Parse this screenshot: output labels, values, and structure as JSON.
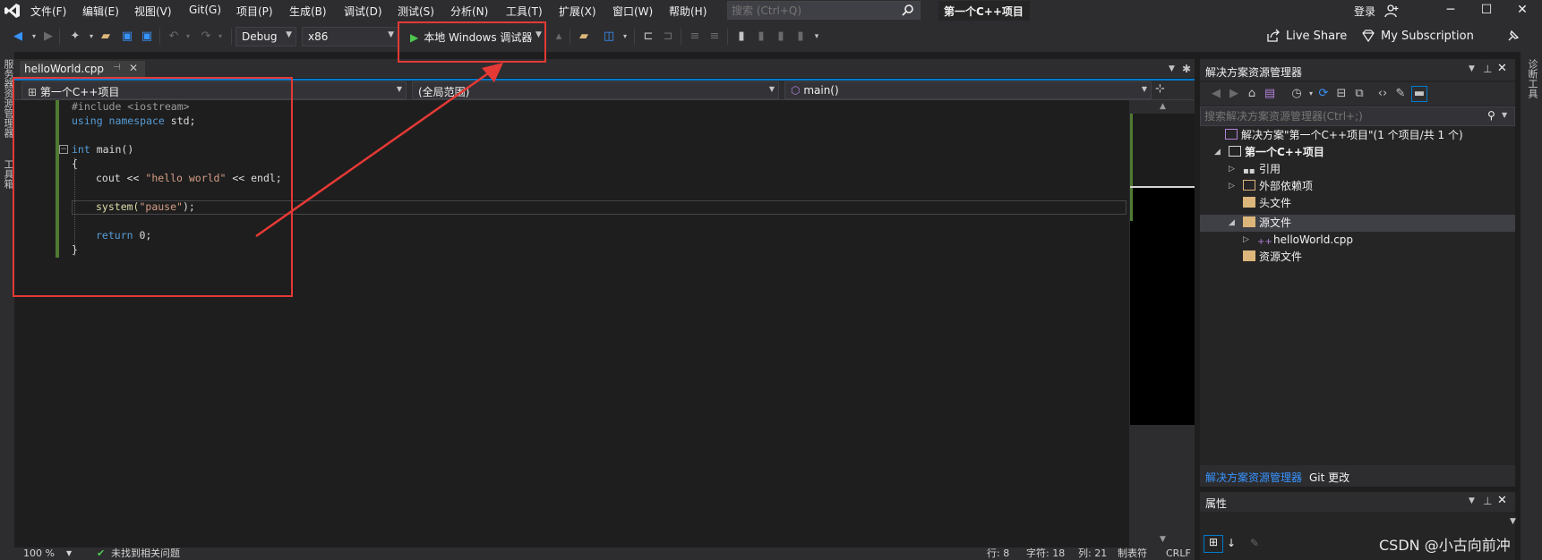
{
  "menubar": {
    "items": [
      "文件(F)",
      "编辑(E)",
      "视图(V)",
      "Git(G)",
      "项目(P)",
      "生成(B)",
      "调试(D)",
      "测试(S)",
      "分析(N)",
      "工具(T)",
      "扩展(X)",
      "窗口(W)",
      "帮助(H)"
    ],
    "search_placeholder": "搜索 (Ctrl+Q)",
    "project_title": "第一个C++项目",
    "login": "登录"
  },
  "toolbar": {
    "configuration": "Debug",
    "platform": "x86",
    "run_label": "本地 Windows 调试器",
    "live_share": "Live Share",
    "subscription": "My Subscription"
  },
  "left_strip": {
    "tabs": [
      "服务器资源管理器",
      "工具箱"
    ]
  },
  "right_strip": {
    "tabs": [
      "诊断工具"
    ]
  },
  "document": {
    "tab_name": "helloWorld.cpp",
    "nav_project": "第一个C++项目",
    "nav_scope": "(全局范围)",
    "nav_member": "main()"
  },
  "code": {
    "line1_pp": "#include <iostream>",
    "line2_kw": "using namespace",
    "line2_rest": " std;",
    "line4_kw": "int",
    "line4_rest": " main()",
    "line5": "{",
    "line6_a": "cout << ",
    "line6_str": "\"hello world\"",
    "line6_b": " << endl;",
    "line8_fn": "system(",
    "line8_str": "\"pause\"",
    "line8_b": ");",
    "line10_kw": "return",
    "line10_rest": " 0;",
    "line11": "}"
  },
  "statusbar": {
    "zoom": "100 %",
    "issues": "未找到相关问题",
    "row": "行: 8",
    "char": "字符: 18",
    "col": "列: 21",
    "tab": "制表符",
    "eol": "CRLF"
  },
  "solution_explorer": {
    "title": "解决方案资源管理器",
    "search_placeholder": "搜索解决方案资源管理器(Ctrl+;)",
    "items": [
      {
        "label": "解决方案\"第一个C++项目\"(1 个项目/共 1 个)"
      },
      {
        "label": "第一个C++项目"
      },
      {
        "label": "引用"
      },
      {
        "label": "外部依赖项"
      },
      {
        "label": "头文件"
      },
      {
        "label": "源文件"
      },
      {
        "label": "helloWorld.cpp"
      },
      {
        "label": "资源文件"
      }
    ],
    "tabs": [
      "解决方案资源管理器",
      "Git 更改"
    ]
  },
  "properties": {
    "title": "属性"
  },
  "watermark": "CSDN @小古向前冲",
  "colors": {
    "accent": "#007acc",
    "annotation": "#e53935",
    "run_green": "#4ec94e",
    "changed_line": "#4e7a32"
  }
}
